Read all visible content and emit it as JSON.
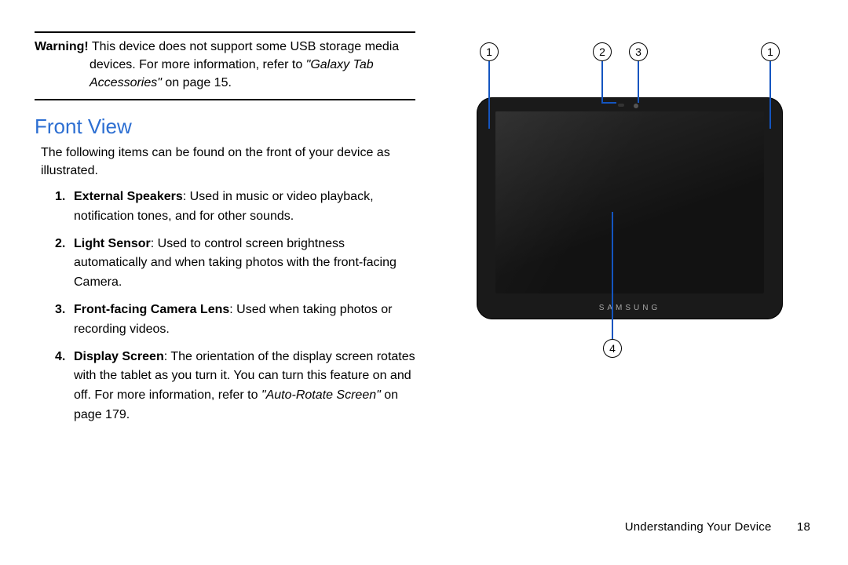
{
  "warning": {
    "label": "Warning!",
    "text_1": " This device does not support some USB storage media devices. For more information, refer to ",
    "ref_title": "\"Galaxy Tab Accessories\"",
    "ref_suffix": "  on page 15."
  },
  "section_title": "Front View",
  "intro": "The following items can be found on the front of your device as illustrated.",
  "items": [
    {
      "term": "External Speakers",
      "text": ": Used in music or video playback, notification tones, and for other sounds."
    },
    {
      "term": "Light Sensor",
      "text": ": Used to control screen brightness automatically and when taking photos with the front-facing Camera."
    },
    {
      "term": "Front-facing Camera Lens",
      "text": ": Used when taking photos or recording videos."
    },
    {
      "term": "Display Screen",
      "text": ": The orientation of the display screen rotates with the tablet as you turn it. You can turn this feature on and off. For more information, refer to ",
      "ref_title": "\"Auto-Rotate Screen\"",
      "ref_suffix": "  on page 179."
    }
  ],
  "device_brand": "SAMSUNG",
  "callouts": {
    "c1": "1",
    "c2": "2",
    "c3": "3",
    "c4": "4"
  },
  "footer": {
    "chapter": "Understanding Your Device",
    "page": "18"
  }
}
